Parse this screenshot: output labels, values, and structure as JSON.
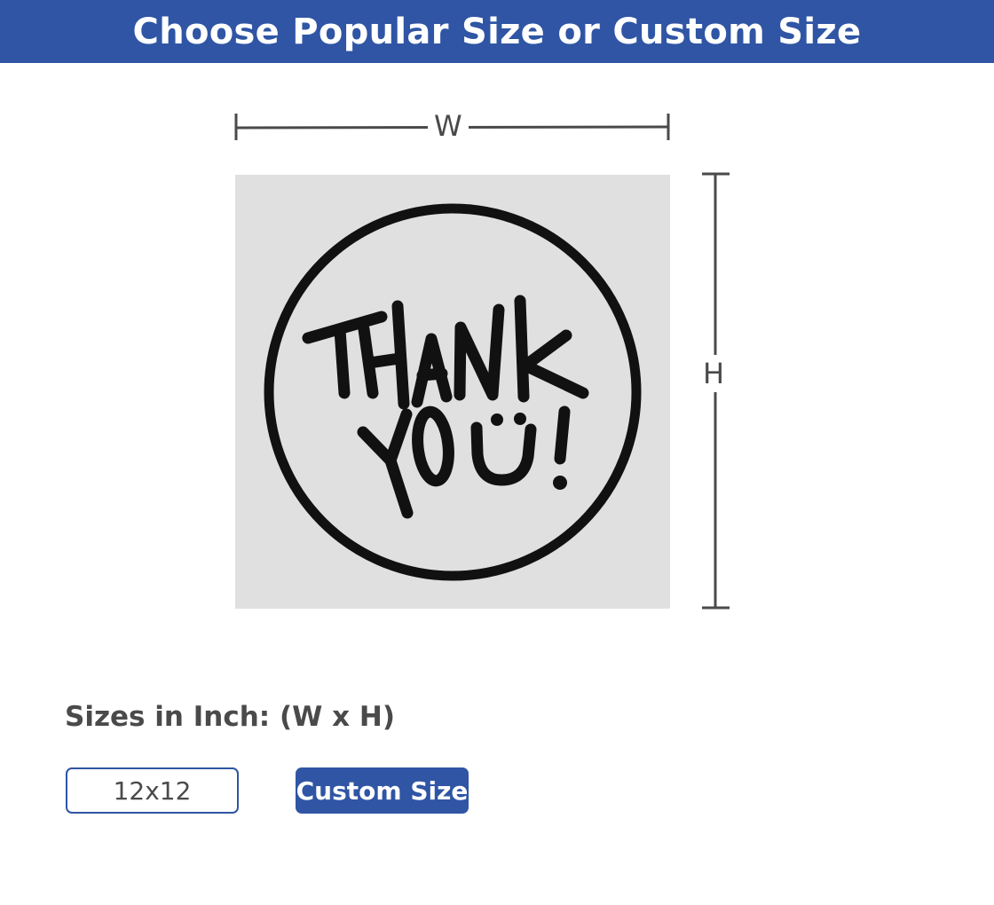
{
  "header": {
    "title": "Choose Popular Size or Custom Size"
  },
  "dimensions": {
    "width_label": "W",
    "height_label": "H",
    "line_color": "#4a4a4a"
  },
  "preview": {
    "background": "#e0e0e0",
    "design_text": "THANK YOU!",
    "design_icon": "smiley-u-icon"
  },
  "sizes": {
    "label": "Sizes in Inch: (W x H)",
    "options": [
      "12x12"
    ],
    "custom_button": "Custom Size"
  },
  "colors": {
    "brand_blue": "#2f55a4",
    "text_gray": "#4a4a4a"
  }
}
